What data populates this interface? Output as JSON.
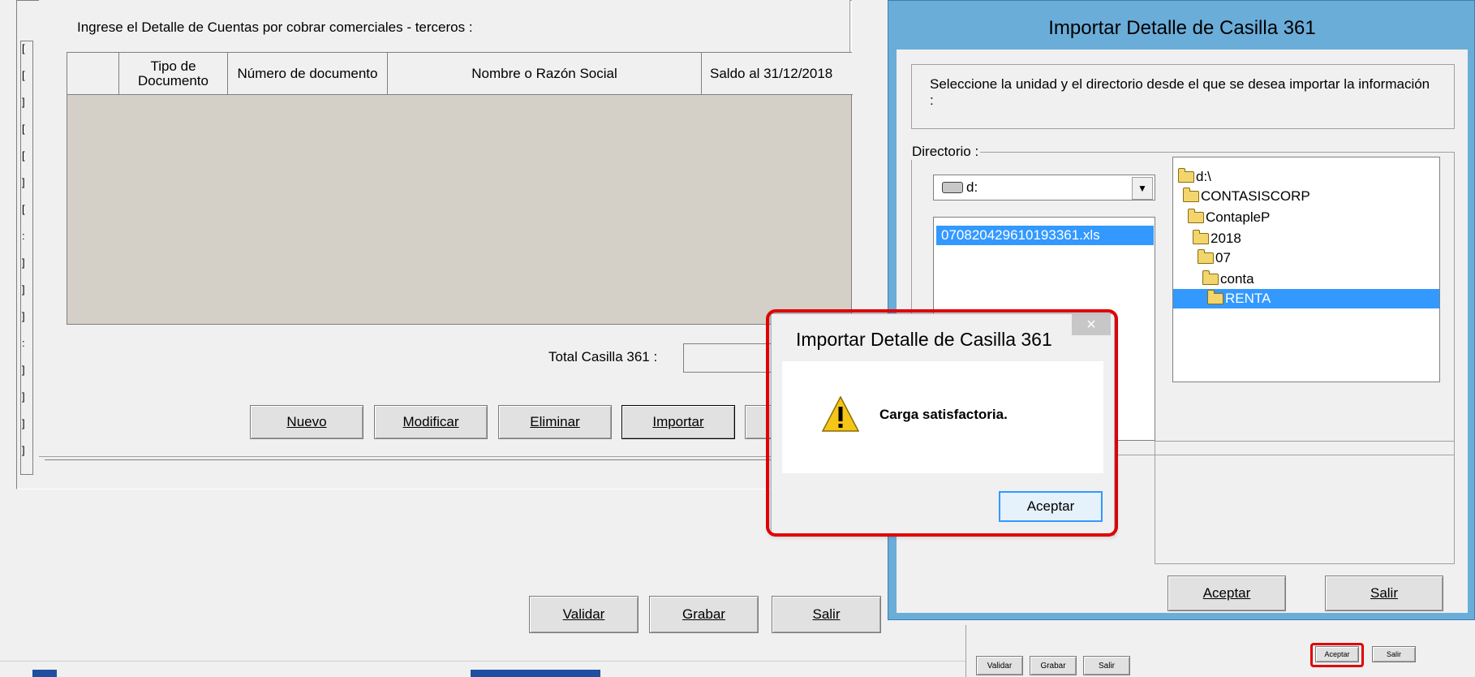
{
  "main_form": {
    "instruction": "Ingrese el Detalle de Cuentas por cobrar comerciales - terceros :",
    "table_headers": [
      "Tipo de Documento",
      "Número de documento",
      "Nombre o Razón Social",
      "Saldo al 31/12/2018"
    ],
    "total_label": "Total Casilla 361 :",
    "total_value": "",
    "buttons": {
      "nuevo": "Nuevo",
      "modificar": "Modificar",
      "eliminar": "Eliminar",
      "importar": "Importar"
    },
    "bottom_buttons": {
      "validar": "Validar",
      "grabar": "Grabar",
      "salir": "Salir"
    },
    "left_marks": [
      "[",
      "[",
      "]",
      "[",
      "[",
      "]",
      "[",
      ":",
      "]",
      "]",
      "]",
      ":",
      "]",
      "]",
      "]",
      "]"
    ]
  },
  "import_window": {
    "title": "Importar Detalle de Casilla 361",
    "description": "Seleccione la unidad y el directorio desde el que se desea importar la información :",
    "group_label": "Directorio :",
    "drive_value": "d:",
    "files": [
      "070820429610193361.xls"
    ],
    "tree": [
      "d:\\",
      "CONTASISCORP",
      "ContapleP",
      "2018",
      "07",
      "conta",
      "RENTA"
    ],
    "buttons": {
      "aceptar": "Aceptar",
      "salir": "Salir"
    }
  },
  "message_box": {
    "title": "Importar Detalle de Casilla 361",
    "message": "Carga satisfactoria.",
    "ok_label": "Aceptar",
    "close_glyph": "×"
  },
  "background_mini": {
    "buttons": [
      "Validar",
      "Grabar",
      "Salir"
    ],
    "right_buttons": [
      "Aceptar",
      "Salir"
    ]
  },
  "colors": {
    "selection": "#3399ff",
    "title_blue": "#6badd9",
    "grid_gray": "#d4d0c8",
    "highlight_red": "#e00000"
  }
}
